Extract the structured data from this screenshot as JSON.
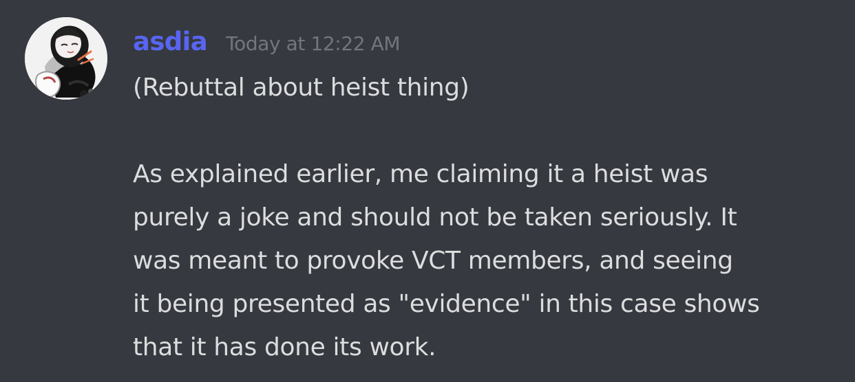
{
  "message": {
    "author": {
      "username": "asdia",
      "username_color": "#5865f2",
      "avatar_icon": "anime-avatar-icon"
    },
    "timestamp": "Today at 12:22 AM",
    "content_lines": [
      "(Rebuttal about heist thing)",
      "",
      "As explained earlier, me claiming it a heist was",
      "purely a joke and should not be taken seriously. It",
      "was meant to provoke VCT members, and seeing",
      "it being presented as \"evidence\" in this case shows",
      "that it has done its work."
    ]
  },
  "theme": {
    "background": "#36393f",
    "text": "#dcddde",
    "muted_text": "#72767d"
  }
}
